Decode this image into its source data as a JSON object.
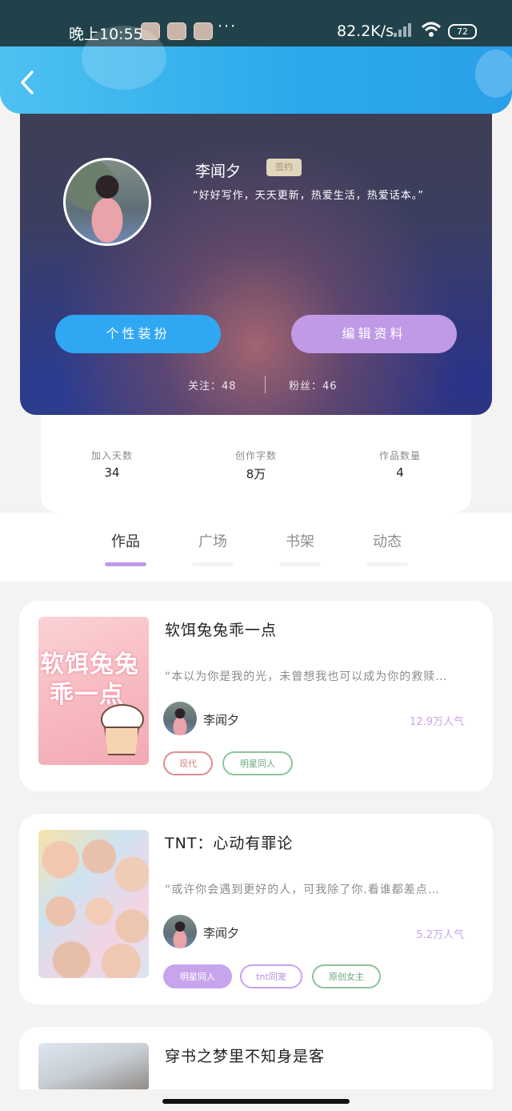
{
  "status_bar": {
    "time": "晚上10:55",
    "more": "···",
    "speed": "82.2K/s",
    "battery": "72"
  },
  "header": {
    "back_icon": "chevron-left-icon"
  },
  "profile": {
    "name": "李闻夕",
    "badge": "签约",
    "motto": "“好好写作，天天更新，热爱生活，热爱话本。”",
    "dress_button": "个性装扮",
    "edit_button": "编辑资料",
    "follow": "关注：48",
    "fans": "粉丝：46"
  },
  "stats": [
    {
      "label": "加入天数",
      "value": "34"
    },
    {
      "label": "创作字数",
      "value": "8万"
    },
    {
      "label": "作品数量",
      "value": "4"
    }
  ],
  "tabs": [
    {
      "label": "作品",
      "active": true
    },
    {
      "label": "广场",
      "active": false
    },
    {
      "label": "书架",
      "active": false
    },
    {
      "label": "动态",
      "active": false
    }
  ],
  "works": [
    {
      "title": "软饵兔兔乖一点",
      "intro": "“本以为你是我的光，未曾想我也可以成为你的救赎…",
      "author": "李闻夕",
      "popularity": "12.9万人气",
      "cover_text_1": "软饵兔兔",
      "cover_text_2": "乖一点",
      "tags": [
        "现代",
        "明星同人"
      ]
    },
    {
      "title": "TNT：心动有罪论",
      "intro": "“或许你会遇到更好的人，可我除了你.看谁都差点…",
      "author": "李闻夕",
      "popularity": "5.2万人气",
      "tags": [
        "明星同人",
        "tnt同宠",
        "原创女主"
      ]
    },
    {
      "title": "穿书之梦里不知身是客"
    }
  ],
  "colors": {
    "accent_blue": "#2fa7f3",
    "accent_purple": "#c09ae6",
    "background": "#f4f3f1"
  }
}
